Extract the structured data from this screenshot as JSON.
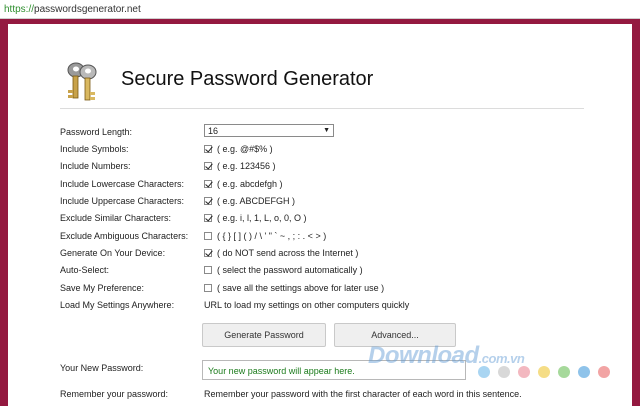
{
  "browser": {
    "url_scheme": "https://",
    "url_host": "passwordsgenerator.net"
  },
  "header": {
    "title": "Secure Password Generator",
    "logo_icon": "keys-icon"
  },
  "settings": {
    "length": {
      "label": "Password Length:",
      "value": "16"
    },
    "symbols": {
      "label": "Include Symbols:",
      "checked": true,
      "hint": "( e.g. @#$% )"
    },
    "numbers": {
      "label": "Include Numbers:",
      "checked": true,
      "hint": "( e.g. 123456 )"
    },
    "lowercase": {
      "label": "Include Lowercase Characters:",
      "checked": true,
      "hint": "( e.g. abcdefgh )"
    },
    "uppercase": {
      "label": "Include Uppercase Characters:",
      "checked": true,
      "hint": "( e.g. ABCDEFGH )"
    },
    "similar": {
      "label": "Exclude Similar Characters:",
      "checked": true,
      "hint": "( e.g. i, l, 1, L, o, 0, O )"
    },
    "ambiguous": {
      "label": "Exclude Ambiguous Characters:",
      "checked": false,
      "hint": "( { } [ ] ( ) / \\ ' \" ` ~ , ; : . < > )"
    },
    "device": {
      "label": "Generate On Your Device:",
      "checked": true,
      "hint": "( do NOT send across the Internet )"
    },
    "autoselect": {
      "label": "Auto-Select:",
      "checked": false,
      "hint": "( select the password automatically )"
    },
    "preference": {
      "label": "Save My Preference:",
      "checked": false,
      "hint": "( save all the settings above for later use )"
    },
    "anywhere": {
      "label": "Load My Settings Anywhere:",
      "hint": "URL to load my settings on other computers quickly"
    }
  },
  "buttons": {
    "generate": "Generate Password",
    "advanced": "Advanced..."
  },
  "result": {
    "label": "Your New Password:",
    "placeholder": "Your new password will appear here.",
    "remember_label": "Remember your password:",
    "remember_text": "Remember your password with the first character of each word in this sentence."
  },
  "watermark": {
    "text": "Download",
    "suffix": ".com.vn"
  },
  "colors": {
    "frame": "#941940",
    "accent_green": "#1b7b1b"
  }
}
